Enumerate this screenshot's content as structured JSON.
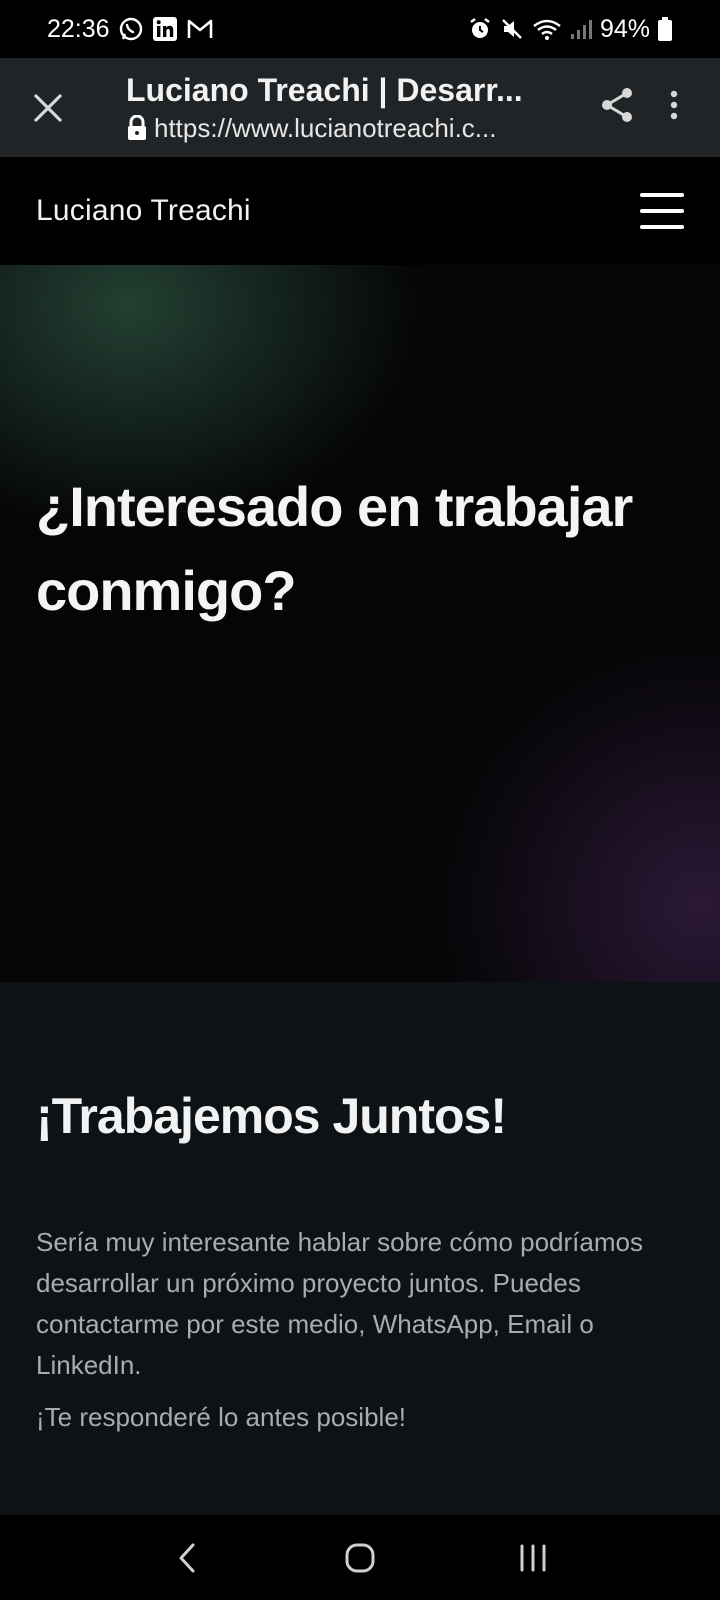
{
  "status_bar": {
    "time": "22:36",
    "battery": "94%",
    "left_icons": [
      "whatsapp-icon",
      "linkedin-icon",
      "gmail-icon"
    ],
    "right_icons": [
      "alarm-icon",
      "mute-icon",
      "wifi-icon",
      "signal-icon",
      "battery-icon"
    ]
  },
  "browser": {
    "page_title": "Luciano Treachi | Desarr...",
    "url": "https://www.lucianotreachi.c..."
  },
  "site_header": {
    "name": "Luciano Treachi"
  },
  "hero": {
    "title": "¿Interesado en trabajar conmigo?"
  },
  "contact": {
    "title": "¡Trabajemos Juntos!",
    "body": "Sería muy interesante hablar sobre cómo podríamos desarrollar un próximo proyecto juntos. Puedes contactarme por este medio, WhatsApp, Email o LinkedIn.",
    "note": "¡Te responderé lo antes posible!"
  },
  "colors": {
    "background": "#000000",
    "browser_bar": "#202427",
    "contact_bg": "#0c1215",
    "muted_text": "#a6acb0"
  }
}
